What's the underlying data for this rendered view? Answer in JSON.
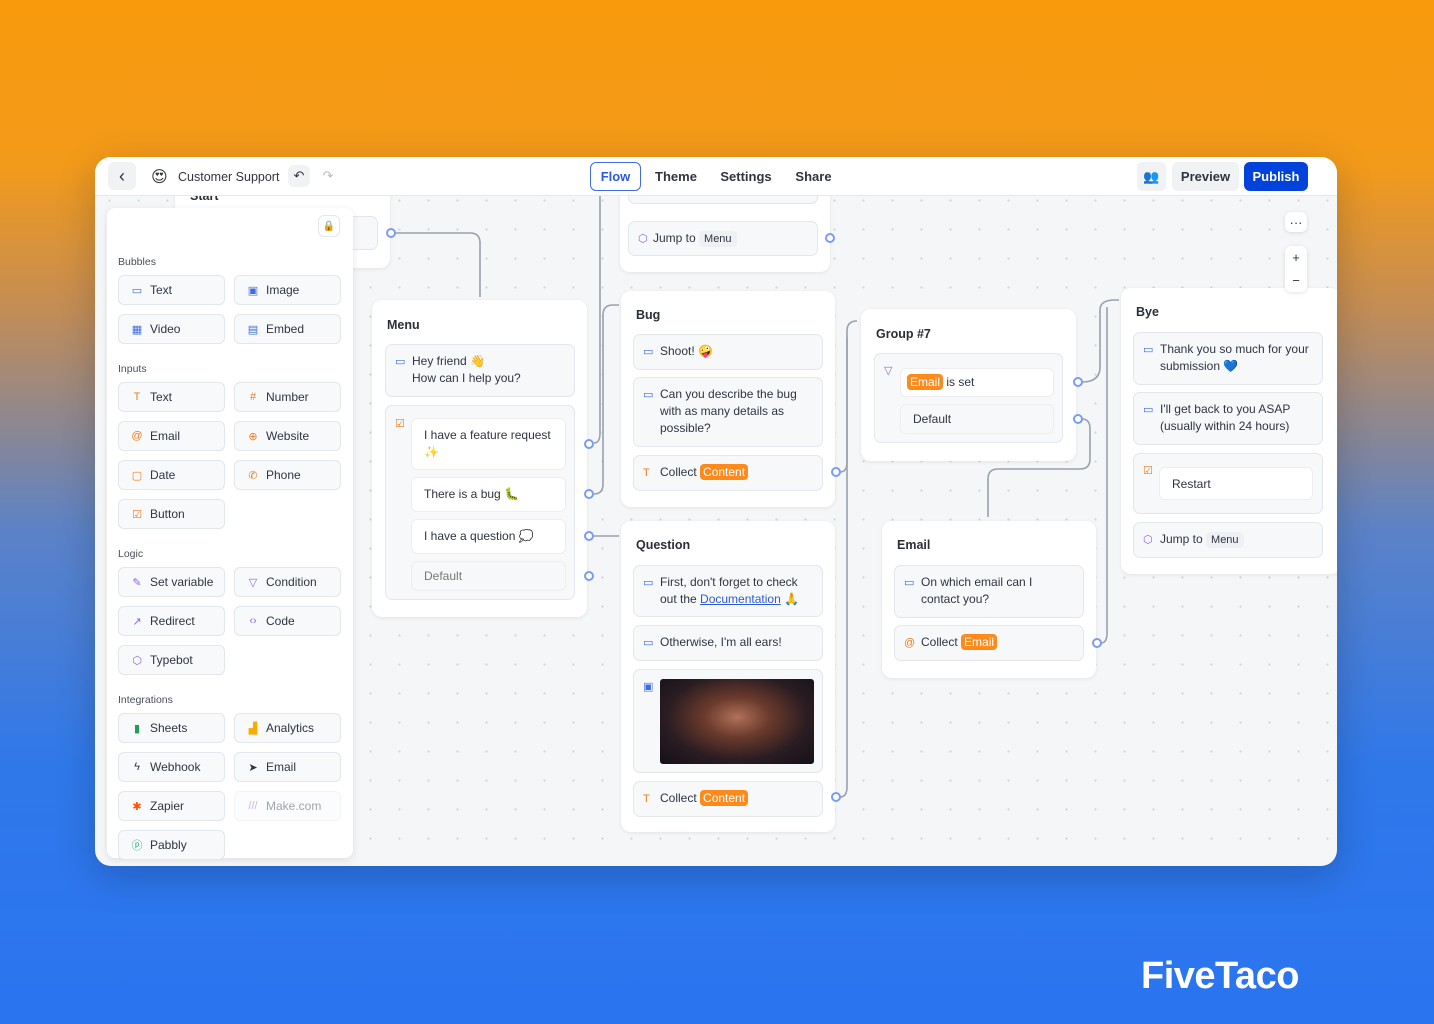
{
  "header": {
    "back_icon": "chevron-left-icon",
    "bot_emoji": "😍",
    "bot_name": "Customer Support",
    "undo_icon": "undo-icon",
    "redo_icon": "redo-icon",
    "tabs": [
      {
        "label": "Flow",
        "active": true
      },
      {
        "label": "Theme"
      },
      {
        "label": "Settings"
      },
      {
        "label": "Share"
      }
    ],
    "collab_icon": "users-icon",
    "preview_label": "Preview",
    "publish_label": "Publish",
    "accent": "#0042da"
  },
  "sidebar": {
    "lock_icon": "lock-icon",
    "sections": [
      {
        "title": "Bubbles",
        "items": [
          {
            "label": "Text",
            "icon": "chat-bubble-icon"
          },
          {
            "label": "Image",
            "icon": "image-icon"
          },
          {
            "label": "Video",
            "icon": "film-icon"
          },
          {
            "label": "Embed",
            "icon": "layout-icon"
          }
        ]
      },
      {
        "title": "Inputs",
        "items": [
          {
            "label": "Text",
            "icon": "text-t-icon"
          },
          {
            "label": "Number",
            "icon": "hash-icon"
          },
          {
            "label": "Email",
            "icon": "at-icon"
          },
          {
            "label": "Website",
            "icon": "globe-icon"
          },
          {
            "label": "Date",
            "icon": "calendar-icon"
          },
          {
            "label": "Phone",
            "icon": "phone-icon"
          },
          {
            "label": "Button",
            "icon": "checkbox-icon"
          }
        ]
      },
      {
        "title": "Logic",
        "items": [
          {
            "label": "Set variable",
            "icon": "pen-icon"
          },
          {
            "label": "Condition",
            "icon": "filter-icon"
          },
          {
            "label": "Redirect",
            "icon": "external-link-icon"
          },
          {
            "label": "Code",
            "icon": "code-icon"
          },
          {
            "label": "Typebot",
            "icon": "cube-icon"
          }
        ]
      },
      {
        "title": "Integrations",
        "items": [
          {
            "label": "Sheets",
            "icon": "sheets-icon"
          },
          {
            "label": "Analytics",
            "icon": "analytics-icon"
          },
          {
            "label": "Webhook",
            "icon": "bolt-icon"
          },
          {
            "label": "Email",
            "icon": "send-icon"
          },
          {
            "label": "Zapier",
            "icon": "zapier-icon"
          },
          {
            "label": "Make.com",
            "icon": "make-icon"
          },
          {
            "label": "Pabbly",
            "icon": "pabbly-icon"
          }
        ]
      }
    ]
  },
  "canvas": {
    "start": {
      "title": "Start"
    },
    "top_group": {
      "jump_label": "Jump to",
      "jump_target": "Menu"
    },
    "menu": {
      "title": "Menu",
      "bubble_line1": "Hey friend 👋",
      "bubble_line2": "How can I help you?",
      "choices": [
        "I have a feature request ✨",
        "There is a bug 🐛",
        "I have a question 💭"
      ],
      "default": "Default"
    },
    "bug": {
      "title": "Bug",
      "bubble1": "Shoot! 🤪",
      "bubble2": "Can you describe the bug with as many details as possible?",
      "collect_label": "Collect",
      "collect_var": "Content"
    },
    "question": {
      "title": "Question",
      "bubble1_pre": "First, don't forget to check out the ",
      "bubble1_link": "Documentation",
      "bubble1_post": " 🙏",
      "bubble2": "Otherwise, I'm all ears!",
      "collect_label": "Collect",
      "collect_var": "Content"
    },
    "group7": {
      "title": "Group #7",
      "cond_var": "Email",
      "cond_text": "is set",
      "default": "Default"
    },
    "email": {
      "title": "Email",
      "bubble": "On which email can I contact you?",
      "collect_label": "Collect",
      "collect_var": "Email"
    },
    "bye": {
      "title": "Bye",
      "bubble1": "Thank you so much for your submission 💙",
      "bubble2": "I'll get back to you ASAP (usually within 24 hours)",
      "restart": "Restart",
      "jump_label": "Jump to",
      "jump_target": "Menu"
    },
    "zoom": {
      "more": "···",
      "plus": "+",
      "minus": "−"
    }
  },
  "brand": "FiveTaco",
  "colors": {
    "variable_tag": "#ff8a1c",
    "port": "#7b9cf3"
  }
}
